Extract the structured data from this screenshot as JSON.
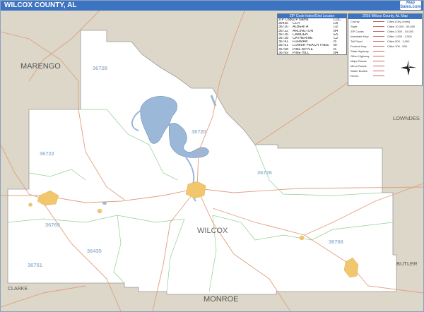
{
  "title": "WILCOX COUNTY, AL",
  "logo": {
    "line1": "Map",
    "line2": "Sales.com"
  },
  "zip_table": {
    "header": "ZIP Code Index/Grid Locator",
    "columns": [
      "ZIP Code",
      "ZIP Name",
      "LOC"
    ],
    "rows": [
      [
        "36435",
        "COY",
        "D6"
      ],
      [
        "36720",
        "ALBERTA",
        "D2"
      ],
      [
        "36722",
        "ARLINGTON",
        "B4"
      ],
      [
        "36726",
        "CAMDEN",
        "E5"
      ],
      [
        "36728",
        "CATHERINE",
        "C2"
      ],
      [
        "36741",
        "FURMAN",
        "I5"
      ],
      [
        "36751",
        "LOWER PEACH TREE",
        "B7"
      ],
      [
        "36768",
        "PINE APPLE",
        "I6"
      ],
      [
        "36769",
        "PINE HILL",
        "B4"
      ]
    ]
  },
  "legend": {
    "header": "2016 Wilcox County, AL Map",
    "rows": [
      {
        "label": "County",
        "right": "Cities (City Limits)"
      },
      {
        "label": "State",
        "right": "Cities 10,000 - 50,000"
      },
      {
        "label": "ZIP Codes",
        "right": "Cities 2,500 - 10,000"
      },
      {
        "label": "Interstate Hwy",
        "right": "Cities 1,000 - 2,500"
      },
      {
        "label": "Toll Road",
        "right": "Cities 500 - 1,000"
      },
      {
        "label": "Federal Hwy",
        "right": "Cities 100 - 500"
      },
      {
        "label": "State Highway",
        "right": ""
      },
      {
        "label": "Other Highway",
        "right": ""
      },
      {
        "label": "Major Roads",
        "right": ""
      },
      {
        "label": "Minor Roads",
        "right": ""
      },
      {
        "label": "Water Bodies",
        "right": ""
      },
      {
        "label": "Rivers",
        "right": ""
      }
    ]
  },
  "map_labels": {
    "marengo": "MARENGO",
    "lowndes": "LOWNDES",
    "butler": "BUTLER",
    "clarke": "CLARKE",
    "monroe": "MONROE",
    "wilcox": "WILCOX",
    "zip_36728": "36728",
    "zip_36720": "36720",
    "zip_36722": "36722",
    "zip_36726": "36726",
    "zip_36769": "36769",
    "zip_36435": "36435",
    "zip_36768": "36768",
    "zip_36751": "36751"
  },
  "colors": {
    "title_bg": "#3d74c2",
    "outside_county": "#dcd7c8",
    "county_fill": "#ffffff",
    "water": "#9cb8d8",
    "roads": "#e0a080",
    "zip_lines": "#8fd08f",
    "cities": "#f2c66c",
    "zip_label": "#9bb7d1"
  }
}
